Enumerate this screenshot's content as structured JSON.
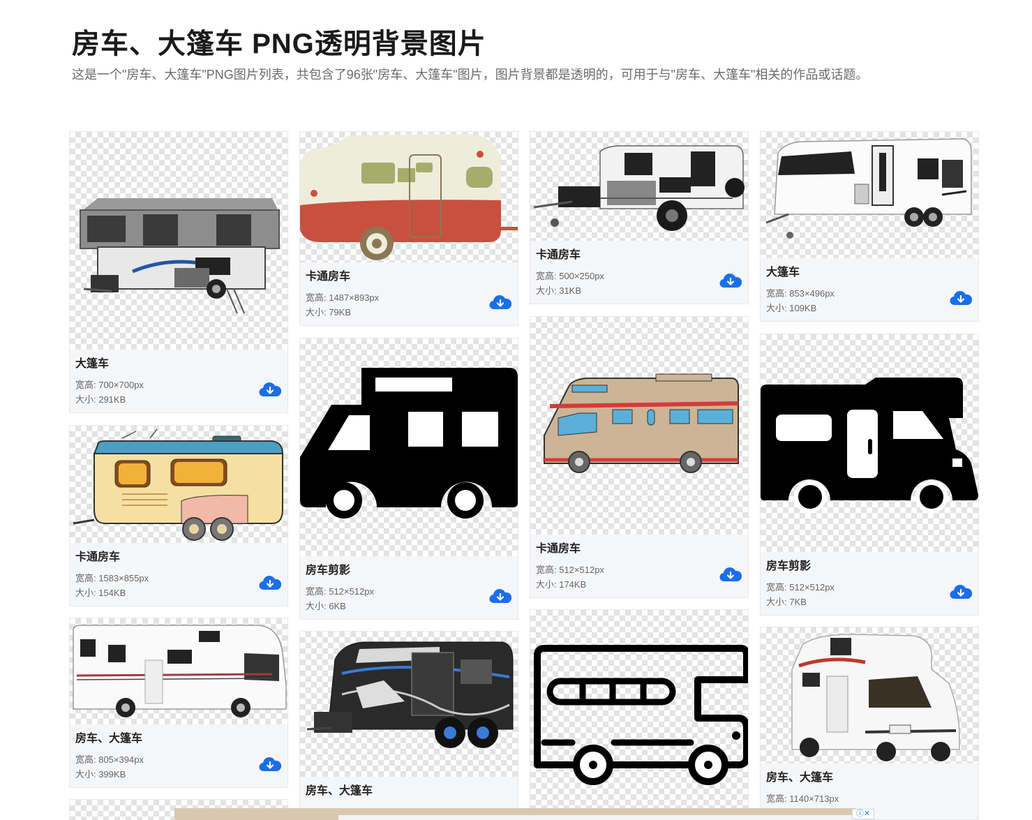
{
  "page": {
    "title": "房车、大篷车 PNG透明背景图片",
    "description": "这是一个\"房车、大篷车\"PNG图片列表，共包含了96张\"房车、大篷车\"图片，图片背景都是透明的，可用于与\"房车、大篷车\"相关的作品或话题。"
  },
  "labels": {
    "size_prefix": "宽高: ",
    "file_prefix": "大小: "
  },
  "cards": [
    {
      "title": "大篷车",
      "dims": "宽高: 700×700px",
      "filesize": "大小: 291KB",
      "icon": "popup-camper-photo"
    },
    {
      "title": "卡通房车",
      "dims": "宽高: 1583×855px",
      "filesize": "大小: 154KB",
      "icon": "cartoon-trailer"
    },
    {
      "title": "房车、大篷车",
      "dims": "宽高: 805×394px",
      "filesize": "大小: 399KB",
      "icon": "motorhome-photo"
    },
    {
      "title": "卡通房车",
      "dims": "宽高: 1487×893px",
      "filesize": "大小: 79KB",
      "icon": "retro-trailer"
    },
    {
      "title": "房车剪影",
      "dims": "宽高: 512×512px",
      "filesize": "大小: 6KB",
      "icon": "rv-silhouette"
    },
    {
      "title": "房车、大篷车",
      "dims": "",
      "filesize": "",
      "icon": "offroad-caravan-photo"
    },
    {
      "title": "卡通房车",
      "dims": "宽高: 500×250px",
      "filesize": "大小: 31KB",
      "icon": "offroad-trailer-photo"
    },
    {
      "title": "卡通房车",
      "dims": "宽高: 512×512px",
      "filesize": "大小: 174KB",
      "icon": "cartoon-motorhome"
    },
    {
      "title": "",
      "dims": "",
      "filesize": "",
      "icon": "bus-outline"
    },
    {
      "title": "大篷车",
      "dims": "宽高: 853×496px",
      "filesize": "大小: 109KB",
      "icon": "caravan-photo"
    },
    {
      "title": "房车剪影",
      "dims": "宽高: 512×512px",
      "filesize": "大小: 7KB",
      "icon": "motorhome-silhouette"
    },
    {
      "title": "房车、大篷车",
      "dims": "宽高: 1140×713px",
      "filesize": "",
      "icon": "motorhome-photo-2"
    }
  ],
  "colors": {
    "accent": "#1a6fe8",
    "card_bg": "#f5f6f8",
    "title": "#1a1a1a",
    "muted": "#6b6b6b"
  },
  "ad": {
    "close_label": "ⓘ✕"
  }
}
